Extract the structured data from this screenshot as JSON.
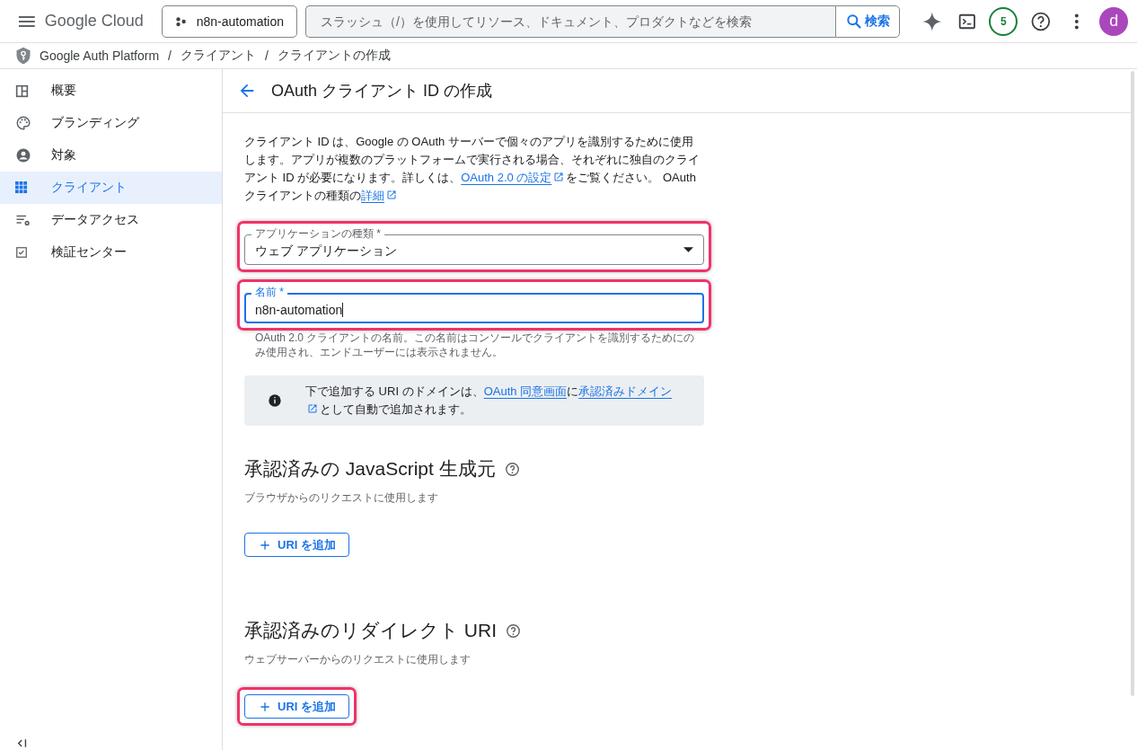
{
  "header": {
    "product": "Google Cloud",
    "project": "n8n-automation",
    "search": {
      "placeholder": "スラッシュ（/）を使用してリソース、ドキュメント、プロダクトなどを検索",
      "button": "検索"
    },
    "notifications": "5",
    "avatar": "d"
  },
  "breadcrumb": [
    {
      "kind": "link",
      "text": "Google Auth Platform"
    },
    {
      "kind": "separator",
      "text": "/"
    },
    {
      "kind": "link",
      "text": "クライアント"
    },
    {
      "kind": "separator",
      "text": "/"
    },
    {
      "kind": "link",
      "text": "クライアントの作成"
    }
  ],
  "sidebar": {
    "items": [
      {
        "label": "概要",
        "selected": false
      },
      {
        "label": "ブランディング",
        "selected": false
      },
      {
        "label": "対象",
        "selected": false
      },
      {
        "label": "クライアント",
        "selected": true
      },
      {
        "label": "データアクセス",
        "selected": false
      },
      {
        "label": "検証センター",
        "selected": false
      }
    ]
  },
  "page": {
    "title": "OAuth クライアント ID の作成",
    "intro": [
      {
        "text": "クライアント ID は、Google の OAuth サーバーで個々のアプリを識別するために使用します。アプリが複数のプラットフォームで実行される場合、それぞれに独自のクライアント ID が必要になります。詳しくは、",
        "link": false
      },
      {
        "text": "OAuth 2.0 の設定",
        "link": true
      },
      {
        "text": "をご覧ください。 OAuth クライアントの種類の",
        "link": false
      },
      {
        "text": "詳細",
        "link": true
      }
    ],
    "app_type": {
      "label": "アプリケーションの種類 *",
      "value": "ウェブ アプリケーション",
      "highlighted": true
    },
    "name_field": {
      "label": "名前 *",
      "value": "n8n-automation",
      "focused": true,
      "highlighted": true,
      "hint": "OAuth 2.0 クライアントの名前。この名前はコンソールでクライアントを識別するためにのみ使用され、エンドユーザーには表示されません。"
    },
    "info": [
      {
        "text": "下で追加する URI のドメインは、",
        "link": false
      },
      {
        "text": "OAuth 同意画面",
        "link": true
      },
      {
        "text": "に",
        "link": false
      },
      {
        "text": "承認済みドメイン",
        "link": true
      },
      {
        "text": "として自動で追加されます。",
        "link": false
      }
    ],
    "sections": [
      {
        "title": "承認済みの JavaScript 生成元",
        "description": "ブラウザからのリクエストに使用します",
        "button": "URI を追加",
        "highlighted": false
      },
      {
        "title": "承認済みのリダイレクト URI",
        "description": "ウェブサーバーからのリクエストに使用します",
        "button": "URI を追加",
        "highlighted": true
      }
    ]
  }
}
